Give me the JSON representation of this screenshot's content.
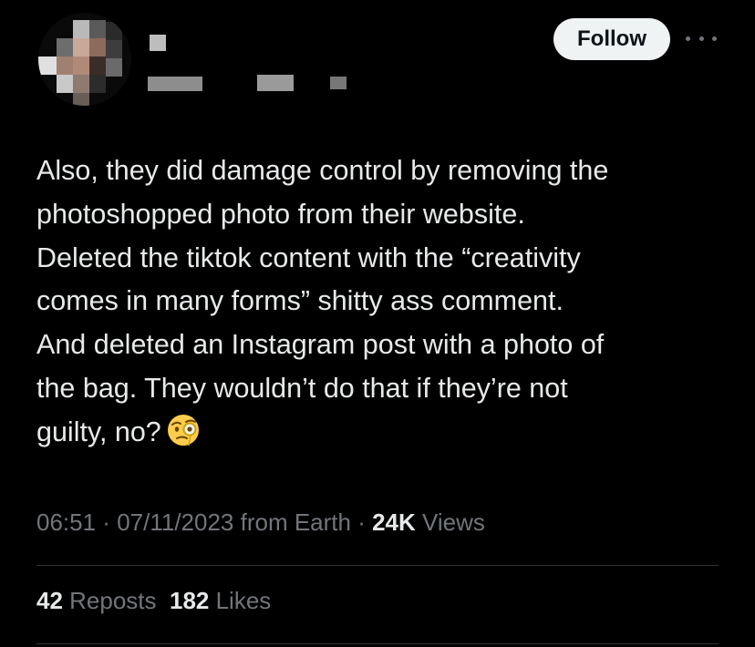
{
  "header": {
    "follow_label": "Follow"
  },
  "tweet": {
    "text_lines": [
      "Also, they did damage control by removing the",
      "photoshopped photo from their website.",
      "Deleted the tiktok content with the “creativity",
      "comes in many forms” shitty ass comment.",
      "And deleted an Instagram post with a photo of",
      "the bag. They wouldn’t do that if they’re not",
      "guilty, no?"
    ],
    "emoji": "face-with-monocle"
  },
  "meta": {
    "time": "06:51",
    "sep1": " · ",
    "date": "07/11/2023",
    "location": " from Earth",
    "sep2": " · ",
    "views_count": "24K",
    "views_label": " Views"
  },
  "stats": {
    "reposts_count": "42",
    "reposts_label": " Reposts",
    "likes_count": "182",
    "likes_label": " Likes"
  },
  "colors": {
    "background": "#000000",
    "text_primary": "#e7e9ea",
    "text_secondary": "#71767b",
    "divider": "#2f3336",
    "follow_bg": "#eff3f4",
    "follow_text": "#0f1419"
  }
}
